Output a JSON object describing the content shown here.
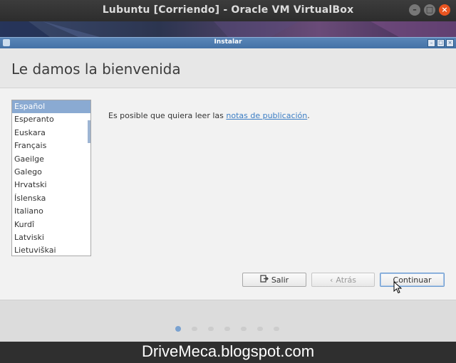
{
  "window": {
    "title": "Lubuntu [Corriendo] - Oracle VM VirtualBox",
    "buttons": [
      "minimize",
      "maximize",
      "close"
    ]
  },
  "installer": {
    "title": "Instalar",
    "heading": "Le damos la bienvenida",
    "languages": [
      "Español",
      "Esperanto",
      "Euskara",
      "Français",
      "Gaeilge",
      "Galego",
      "Hrvatski",
      "Íslenska",
      "Italiano",
      "Kurdî",
      "Latviski",
      "Lietuviškai"
    ],
    "selected_language": "Español",
    "release_text_prefix": "Es posible que quiera leer las ",
    "release_link": "notas de publicación",
    "release_text_suffix": ".",
    "buttons": {
      "quit": "Salir",
      "back": "Atrás",
      "continue": "Continuar"
    },
    "progress": {
      "current_step": 1,
      "total_steps": 7
    }
  },
  "watermark": "DriveMeca.blogspot.com"
}
